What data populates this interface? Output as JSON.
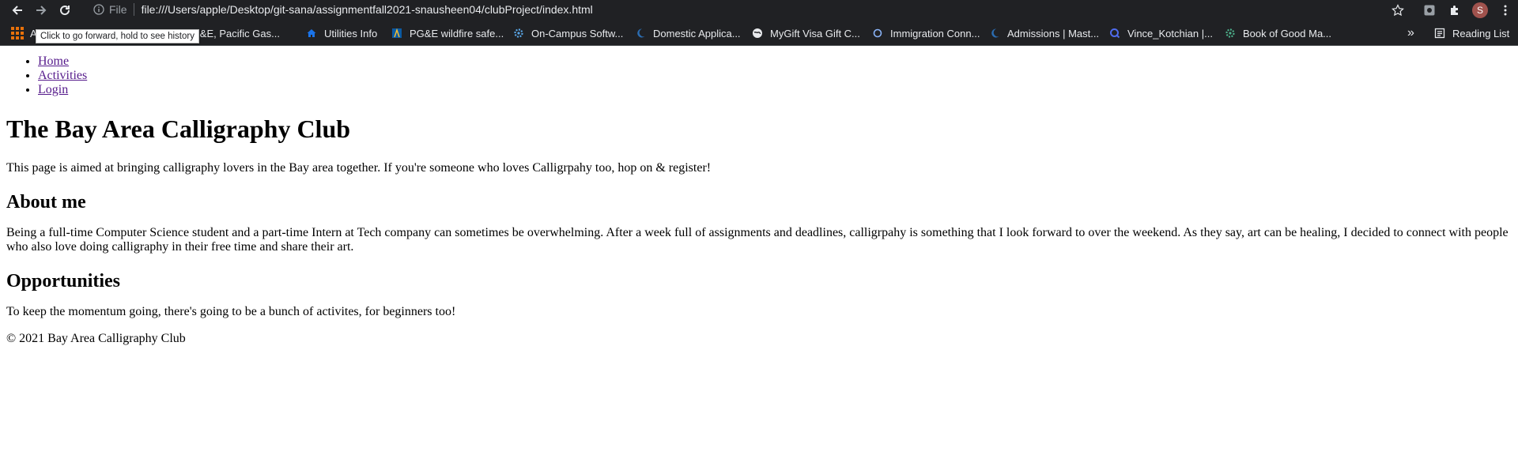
{
  "browser": {
    "scheme_label": "File",
    "url": "file:///Users/apple/Desktop/git-sana/assignmentfall2021-snausheen04/clubProject/index.html",
    "avatar_letter": "S",
    "tooltip": "Click to go forward, hold to see history",
    "bookmarks": [
      {
        "label": "A",
        "icon": "apps-grid-icon"
      },
      {
        "label": "PG&E, Pacific Gas...",
        "icon": "pge-icon"
      },
      {
        "label": "Utilities Info",
        "icon": "house-icon"
      },
      {
        "label": "PG&E wildfire safe...",
        "icon": "pge-icon"
      },
      {
        "label": "On-Campus Softw...",
        "icon": "gear-icon"
      },
      {
        "label": "Domestic Applica...",
        "icon": "crescent-icon"
      },
      {
        "label": "MyGift Visa Gift C...",
        "icon": "globe-icon"
      },
      {
        "label": "Immigration Conn...",
        "icon": "circle-icon"
      },
      {
        "label": "Admissions | Mast...",
        "icon": "crescent-icon"
      },
      {
        "label": "Vince_Kotchian |...",
        "icon": "q-icon"
      },
      {
        "label": "Book of Good Ma...",
        "icon": "gear-icon"
      }
    ],
    "overflow": "»",
    "reading_list": "Reading List"
  },
  "page": {
    "nav": [
      "Home",
      "Activities",
      "Login"
    ],
    "title": "The Bay Area Calligraphy Club",
    "intro": "This page is aimed at bringing calligraphy lovers in the Bay area together. If you're someone who loves Calligrpahy too, hop on & register!",
    "about_heading": "About me",
    "about_text": "Being a full-time Computer Science student and a part-time Intern at Tech company can sometimes be overwhelming. After a week full of assignments and deadlines, calligrpahy is something that I look forward to over the weekend. As they say, art can be healing, I decided to connect with people who also love doing calligraphy in their free time and share their art.",
    "opp_heading": "Opportunities",
    "opp_text": "To keep the momentum going, there's going to be a bunch of activites, for beginners too!",
    "footer": "© 2021 Bay Area Calligraphy Club"
  },
  "colors": {
    "chrome_bg": "#202124",
    "link_visited": "#551a8b",
    "apps_icon": "#e8710a",
    "avatar": "#a0524d"
  }
}
